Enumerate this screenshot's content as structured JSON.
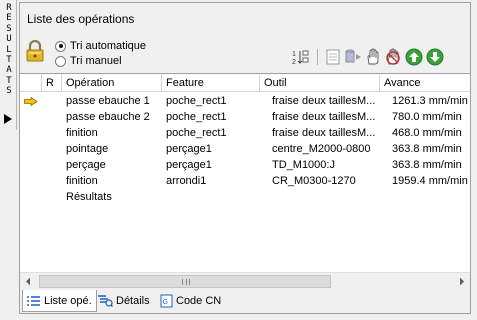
{
  "side_tab": {
    "letters": [
      "R",
      "E",
      "S",
      "U",
      "L",
      "T",
      "A",
      "T",
      "S"
    ]
  },
  "panel": {
    "title": "Liste des opérations"
  },
  "sort": {
    "auto_label": "Tri automatique",
    "manual_label": "Tri manuel",
    "selected": "auto"
  },
  "toolbar": {
    "icons": [
      "sort-order-icon",
      "list-icon",
      "simulate-icon",
      "hand-icon",
      "no-hand-icon",
      "move-up-icon",
      "move-down-icon"
    ]
  },
  "table": {
    "headers": {
      "r": "R",
      "operation": "Opération",
      "feature": "Feature",
      "tool": "Outil",
      "feed": "Avance"
    },
    "rows": [
      {
        "operation": "passe ebauche 1",
        "feature": "poche_rect1",
        "tool": "fraise deux taillesM...",
        "feed": "1261.3 mm/min",
        "current": true
      },
      {
        "operation": "passe ebauche 2",
        "feature": "poche_rect1",
        "tool": "fraise deux taillesM...",
        "feed": "780.0 mm/min",
        "current": false
      },
      {
        "operation": "finition",
        "feature": "poche_rect1",
        "tool": "fraise deux taillesM...",
        "feed": "468.0 mm/min",
        "current": false
      },
      {
        "operation": "pointage",
        "feature": "perçage1",
        "tool": "centre_M2000-0800",
        "feed": "363.8 mm/min",
        "current": false
      },
      {
        "operation": "perçage",
        "feature": "perçage1",
        "tool": "TD_M1000:J",
        "feed": "363.8 mm/min",
        "current": false
      },
      {
        "operation": "finition",
        "feature": "arrondi1",
        "tool": "CR_M0300-1270",
        "feed": "1959.4 mm/min",
        "current": false
      },
      {
        "operation": "Résultats",
        "feature": "",
        "tool": "",
        "feed": "",
        "current": false
      }
    ]
  },
  "tabs": [
    {
      "label": "Liste opé.",
      "icon": "list-icon",
      "active": true
    },
    {
      "label": "Détails",
      "icon": "details-icon",
      "active": false
    },
    {
      "label": "Code CN",
      "icon": "nc-code-icon",
      "active": false
    }
  ],
  "colors": {
    "accent_green": "#3aa13a",
    "arrow_yellow": "#f5c400",
    "lock_gold": "#e3b42a"
  }
}
